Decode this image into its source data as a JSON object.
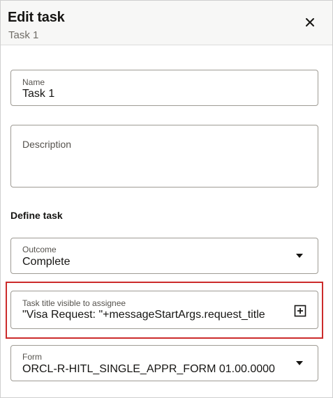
{
  "header": {
    "title": "Edit task",
    "subtitle": "Task 1",
    "close_icon": "close-icon"
  },
  "fields": {
    "name": {
      "label": "Name",
      "value": "Task 1"
    },
    "description": {
      "label": "Description",
      "value": ""
    },
    "outcome": {
      "label": "Outcome",
      "value": "Complete",
      "icon": "chevron-down-icon"
    },
    "task_title": {
      "label": "Task title visible to assignee",
      "value": "\"Visa Request: \"+messageStartArgs.request_title",
      "icon": "expand-plus-icon"
    },
    "form": {
      "label": "Form",
      "value": "ORCL-R-HITL_SINGLE_APPR_FORM 01.00.0000",
      "icon": "chevron-down-icon"
    }
  },
  "section": {
    "define_task": "Define task"
  },
  "colors": {
    "highlight_border": "#cc2b2b",
    "header_bg": "#f7f7f6",
    "field_border": "#9e9b94",
    "text_primary": "#161513",
    "text_secondary": "#6f6c66"
  }
}
